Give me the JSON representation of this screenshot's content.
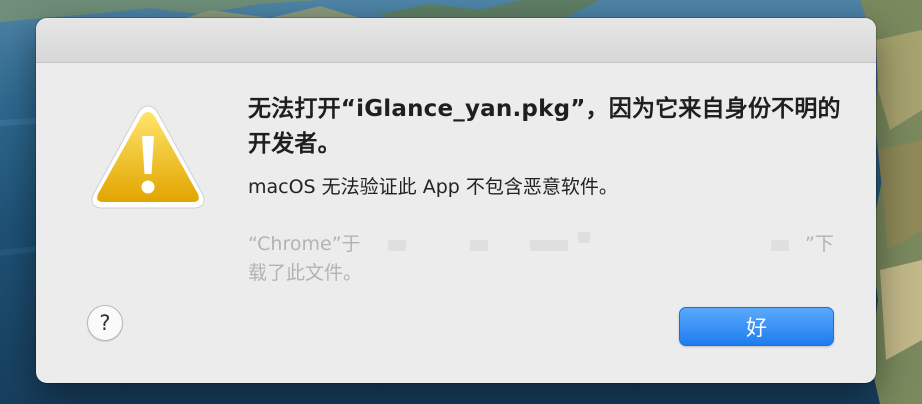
{
  "dialog": {
    "title": "无法打开“iGlance_yan.pkg”，因为它来自身份不明的开发者。",
    "message": "macOS 无法验证此 App 不包含恶意软件。",
    "source_prefix": "“Chrome”于",
    "source_suffix": "”下",
    "source_line2": "载了此文件。",
    "help_label": "?",
    "ok_label": "好"
  },
  "icons": {
    "warning": "warning-triangle-icon",
    "help": "question-mark-icon"
  },
  "colors": {
    "accent": "#1f7cf0",
    "warning": "#f2c200",
    "dialog_bg": "#ececec"
  }
}
